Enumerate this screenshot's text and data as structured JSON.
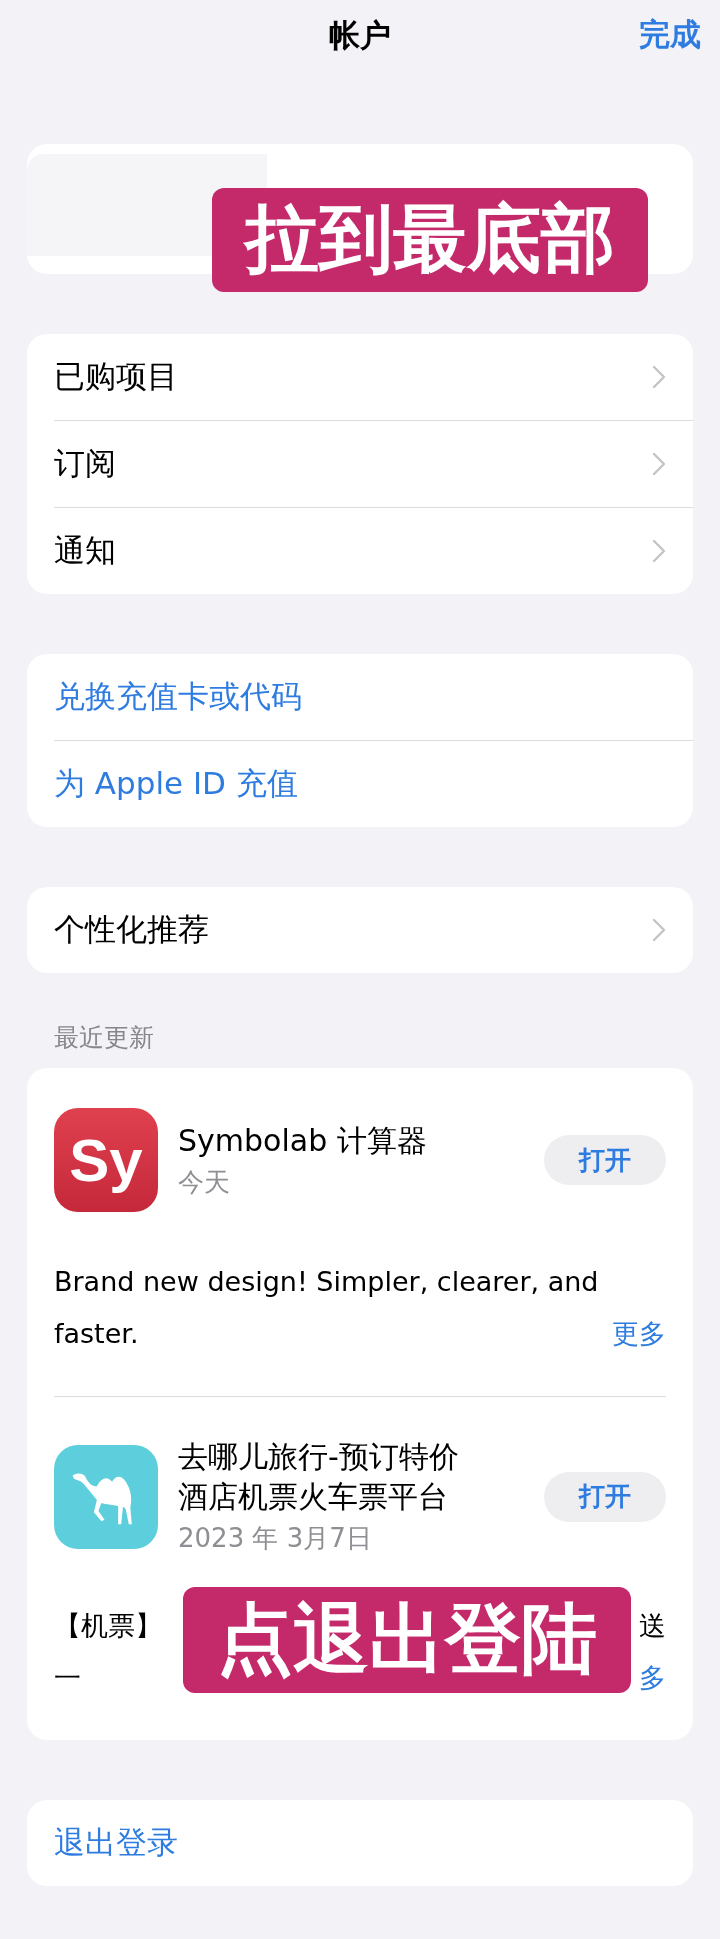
{
  "nav_bar": {
    "title": "帐户",
    "done_button": "完成"
  },
  "menu_groups": [
    {
      "kind": "nav",
      "items": [
        {
          "label": "已购项目"
        },
        {
          "label": "订阅"
        },
        {
          "label": "通知"
        }
      ]
    },
    {
      "kind": "link",
      "items": [
        {
          "label": "兑换充值卡或代码"
        },
        {
          "label": "为 Apple ID 充值"
        }
      ]
    },
    {
      "kind": "nav",
      "items": [
        {
          "label": "个性化推荐"
        }
      ]
    }
  ],
  "recent_updates": {
    "header": "最近更新",
    "apps": [
      {
        "icon_text": "Sy",
        "name_lines": [
          "Symbolab 计算器"
        ],
        "date": "今天",
        "open_button": "打开",
        "description_lines": [
          [
            "Brand new design! Simpler, clearer, and"
          ],
          [
            "faster."
          ]
        ],
        "more_link": "更多"
      },
      {
        "name_lines": [
          "去哪儿旅行-预订特价",
          "酒店机票火车票平台"
        ],
        "date": "2023 年 3月7日",
        "open_button": "打开",
        "description_lines": [
          [
            "【机票】",
            "送"
          ],
          [
            "一"
          ]
        ],
        "more_link": "多"
      }
    ]
  },
  "sign_out": {
    "label": "退出登录"
  },
  "annotations": [
    {
      "text": "拉到最底部"
    },
    {
      "text": "点退出登陆"
    }
  ]
}
